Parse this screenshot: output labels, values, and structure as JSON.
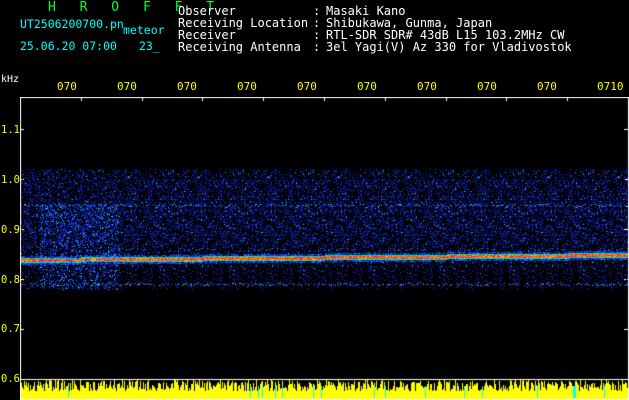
{
  "header": {
    "title": "H R O F F T",
    "filename": "UT2506200700.pn",
    "meteor_label": "meteor",
    "datetime": "25.06.20 07:00",
    "count": "23_"
  },
  "meta": [
    {
      "label": "Observer",
      "value": "Masaki Kano"
    },
    {
      "label": "Receiving Location",
      "value": "Shibukawa, Gunma, Japan"
    },
    {
      "label": "Receiver",
      "value": "RTL-SDR SDR# 43dB L15 103.2MHz CW"
    },
    {
      "label": "Receiving Antenna",
      "value": "3el Yagi(V) Az 330 for Vladivostok"
    }
  ],
  "axis": {
    "unit": "kHz",
    "y_ticks": [
      "1.1",
      "1.0",
      "0.9",
      "0.8",
      "0.7",
      "0.6"
    ],
    "x_ticks": [
      "070",
      "070",
      "070",
      "070",
      "070",
      "070",
      "070",
      "070",
      "070",
      "0710"
    ]
  },
  "colors": {
    "frame": "#ffffff",
    "text_meta": "#ffffff",
    "text_file": "#00ffff",
    "text_title": "#00ff33",
    "ticks": "#ffff00",
    "echo_strong": "#ff3030",
    "echo_mid": "#00ff66",
    "noise": "#0044ff",
    "amplitude_bar": "#ffff00"
  }
}
